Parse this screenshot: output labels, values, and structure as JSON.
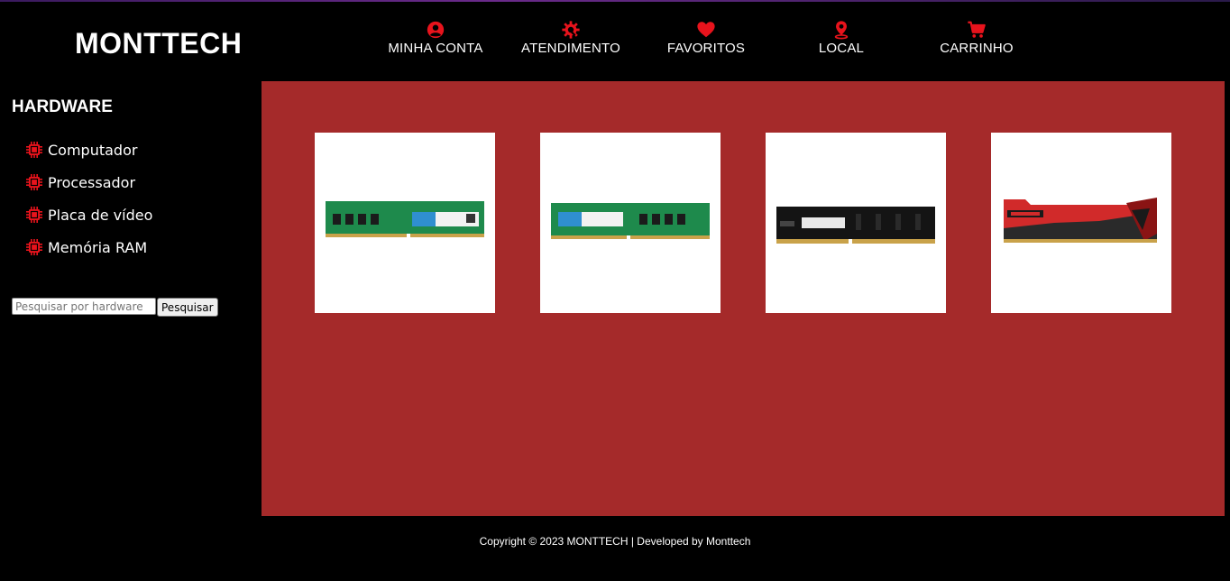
{
  "brand": {
    "name": "MONTTECH",
    "accent": "#e8131c",
    "panel_color": "#a52a2a"
  },
  "nav": {
    "items": [
      {
        "label": "MINHA CONTA",
        "icon": "user-circle-icon"
      },
      {
        "label": "ATENDIMENTO",
        "icon": "gear-wrench-icon"
      },
      {
        "label": "FAVORITOS",
        "icon": "heart-icon"
      },
      {
        "label": "LOCAL",
        "icon": "map-pin-icon"
      },
      {
        "label": "CARRINHO",
        "icon": "cart-icon"
      }
    ]
  },
  "sidebar": {
    "title": "HARDWARE",
    "items": [
      {
        "label": "Computador",
        "icon": "chip-icon"
      },
      {
        "label": "Processador",
        "icon": "chip-icon"
      },
      {
        "label": "Placa de vídeo",
        "icon": "chip-icon"
      },
      {
        "label": "Memória RAM",
        "icon": "chip-icon"
      }
    ],
    "search": {
      "placeholder": "Pesquisar por hardware",
      "button_label": "Pesquisar"
    }
  },
  "products": [
    {
      "image": "green-ram-stick-crucial-icon"
    },
    {
      "image": "green-ram-stick-crucial-icon"
    },
    {
      "image": "black-ram-stick-icon"
    },
    {
      "image": "red-viper-ram-stick-icon"
    }
  ],
  "footer": {
    "text": "Copyright © 2023 MONTTECH | Developed by Monttech"
  }
}
